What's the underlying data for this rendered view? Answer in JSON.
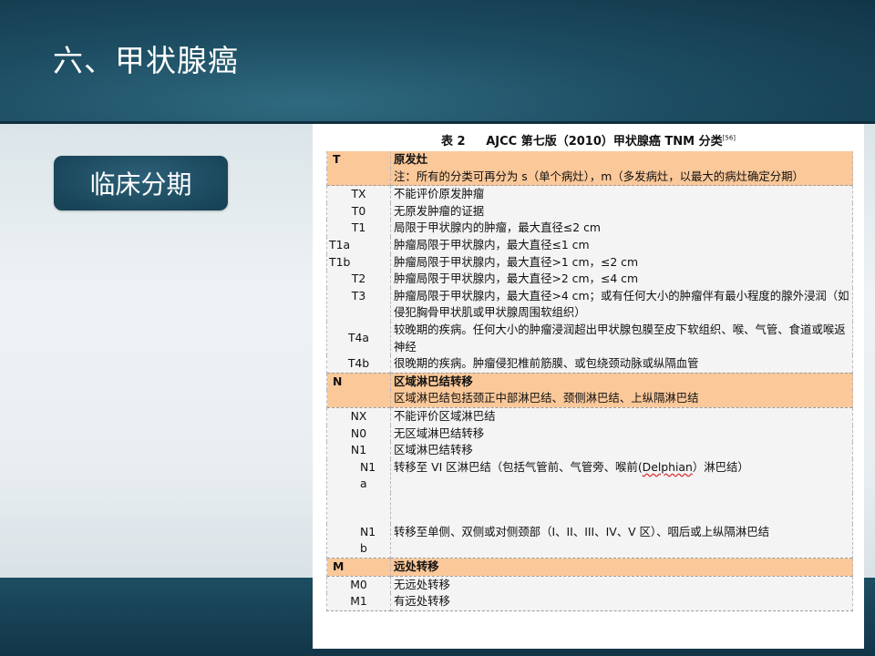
{
  "slide": {
    "title": "六、甲状腺癌",
    "section_button": "临床分期"
  },
  "table": {
    "caption_prefix": "表 2",
    "caption_main": "AJCC 第七版（2010）甲状腺癌 TNM 分类",
    "caption_ref": "[56]",
    "t_section": {
      "code": "T",
      "title": "原发灶",
      "note": "注：所有的分类可再分为 s（单个病灶），m（多发病灶，以最大的病灶确定分期）",
      "rows": [
        {
          "code": "TX",
          "desc": "不能评价原发肿瘤"
        },
        {
          "code": "T0",
          "desc": "无原发肿瘤的证据"
        },
        {
          "code": "T1",
          "desc": "局限于甲状腺内的肿瘤，最大直径≤2 cm"
        },
        {
          "code": "T1a",
          "desc": "肿瘤局限于甲状腺内，最大直径≤1 cm"
        },
        {
          "code": "T1b",
          "desc": "肿瘤局限于甲状腺内，最大直径>1 cm，≤2 cm"
        },
        {
          "code": "T2",
          "desc": "肿瘤局限于甲状腺内，最大直径>2 cm，≤4 cm"
        },
        {
          "code": "T3",
          "desc": "肿瘤局限于甲状腺内，最大直径>4 cm；或有任何大小的肿瘤伴有最小程度的腺外浸润（如侵犯胸骨甲状肌或甲状腺周围软组织）"
        },
        {
          "code": "T4a",
          "desc": "较晚期的疾病。任何大小的肿瘤浸润超出甲状腺包膜至皮下软组织、喉、气管、食道或喉返神经"
        },
        {
          "code": "T4b",
          "desc": "很晚期的疾病。肿瘤侵犯椎前筋膜、或包绕颈动脉或纵隔血管"
        }
      ]
    },
    "n_section": {
      "code": "N",
      "title": "区域淋巴结转移",
      "note": "区域淋巴结包括颈正中部淋巴结、颈侧淋巴结、上纵隔淋巴结",
      "rows": [
        {
          "code": "NX",
          "desc": "不能评价区域淋巴结"
        },
        {
          "code": "N0",
          "desc": "无区域淋巴结转移"
        },
        {
          "code": "N1",
          "desc": "区域淋巴结转移"
        }
      ],
      "n1a": {
        "code_line1": "N1",
        "code_line2": "a",
        "desc_before": "转移至 VI 区淋巴结（包括气管前、气管旁、喉前(",
        "desc_word": "Delphian",
        "desc_after": "）淋巴结）"
      },
      "n1b": {
        "code_line1": "N1",
        "code_line2": "b",
        "desc": "转移至单侧、双侧或对侧颈部（I、II、III、IV、V 区）、咽后或上纵隔淋巴结"
      }
    },
    "m_section": {
      "code": "M",
      "title": "远处转移",
      "rows": [
        {
          "code": "M0",
          "desc": "无远处转移"
        },
        {
          "code": "M1",
          "desc": "有远处转移"
        }
      ]
    }
  },
  "colors": {
    "header_band": "#1d4d62",
    "table_header_fill": "#fbc899",
    "table_body_fill": "#f4f4f4"
  }
}
